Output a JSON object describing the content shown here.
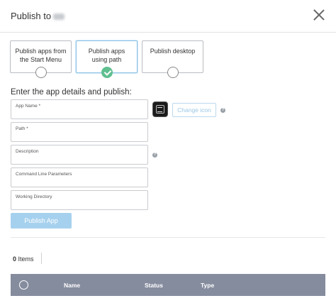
{
  "header": {
    "title": "Publish to"
  },
  "options": [
    {
      "label_line1": "Publish apps from",
      "label_line2": "the Start Menu",
      "selected": false
    },
    {
      "label_line1": "Publish apps",
      "label_line2": "using path",
      "selected": true
    },
    {
      "label_line1": "Publish desktop",
      "label_line2": "",
      "selected": false
    }
  ],
  "form": {
    "section_title": "Enter the app details and publish:",
    "app_name_label": "App Name *",
    "path_label": "Path *",
    "description_label": "Description",
    "cmd_params_label": "Command Line Parameters",
    "working_dir_label": "Working Directory",
    "change_icon_label": "Change icon",
    "help_glyph": "?",
    "publish_label": "Publish App"
  },
  "list": {
    "count": "0",
    "count_suffix": "Items",
    "columns": [
      "Name",
      "Status",
      "Type"
    ]
  },
  "colors": {
    "accent": "#5fbf8f",
    "button": "#a6d1ee",
    "table_header": "#858c9e"
  }
}
